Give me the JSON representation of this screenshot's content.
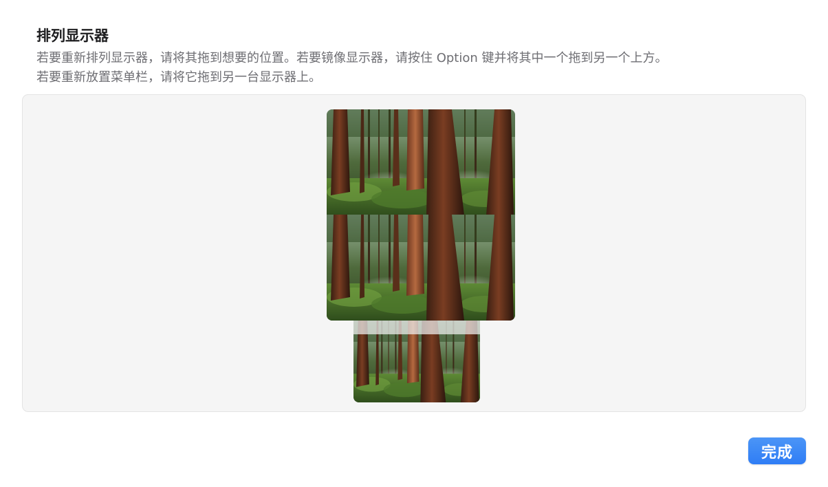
{
  "dialog": {
    "title": "排列显示器",
    "description_line1": "若要重新排列显示器，请将其拖到想要的位置。若要镜像显示器，请按住 Option 键并将其中一个拖到另一个上方。",
    "description_line2": "若要重新放置菜单栏，请将它拖到另一台显示器上。"
  },
  "arrangement": {
    "displays": [
      {
        "name": "main-display",
        "wallpaper_icon": "forest-wallpaper"
      },
      {
        "name": "secondary-display",
        "wallpaper_icon": "forest-wallpaper",
        "has_menubar": true
      }
    ]
  },
  "footer": {
    "done_label": "完成"
  },
  "colors": {
    "accent": "#2f7df5",
    "panel_background": "#f5f5f5",
    "title_text": "#1d1d1f",
    "secondary_text": "#6e6e73"
  }
}
